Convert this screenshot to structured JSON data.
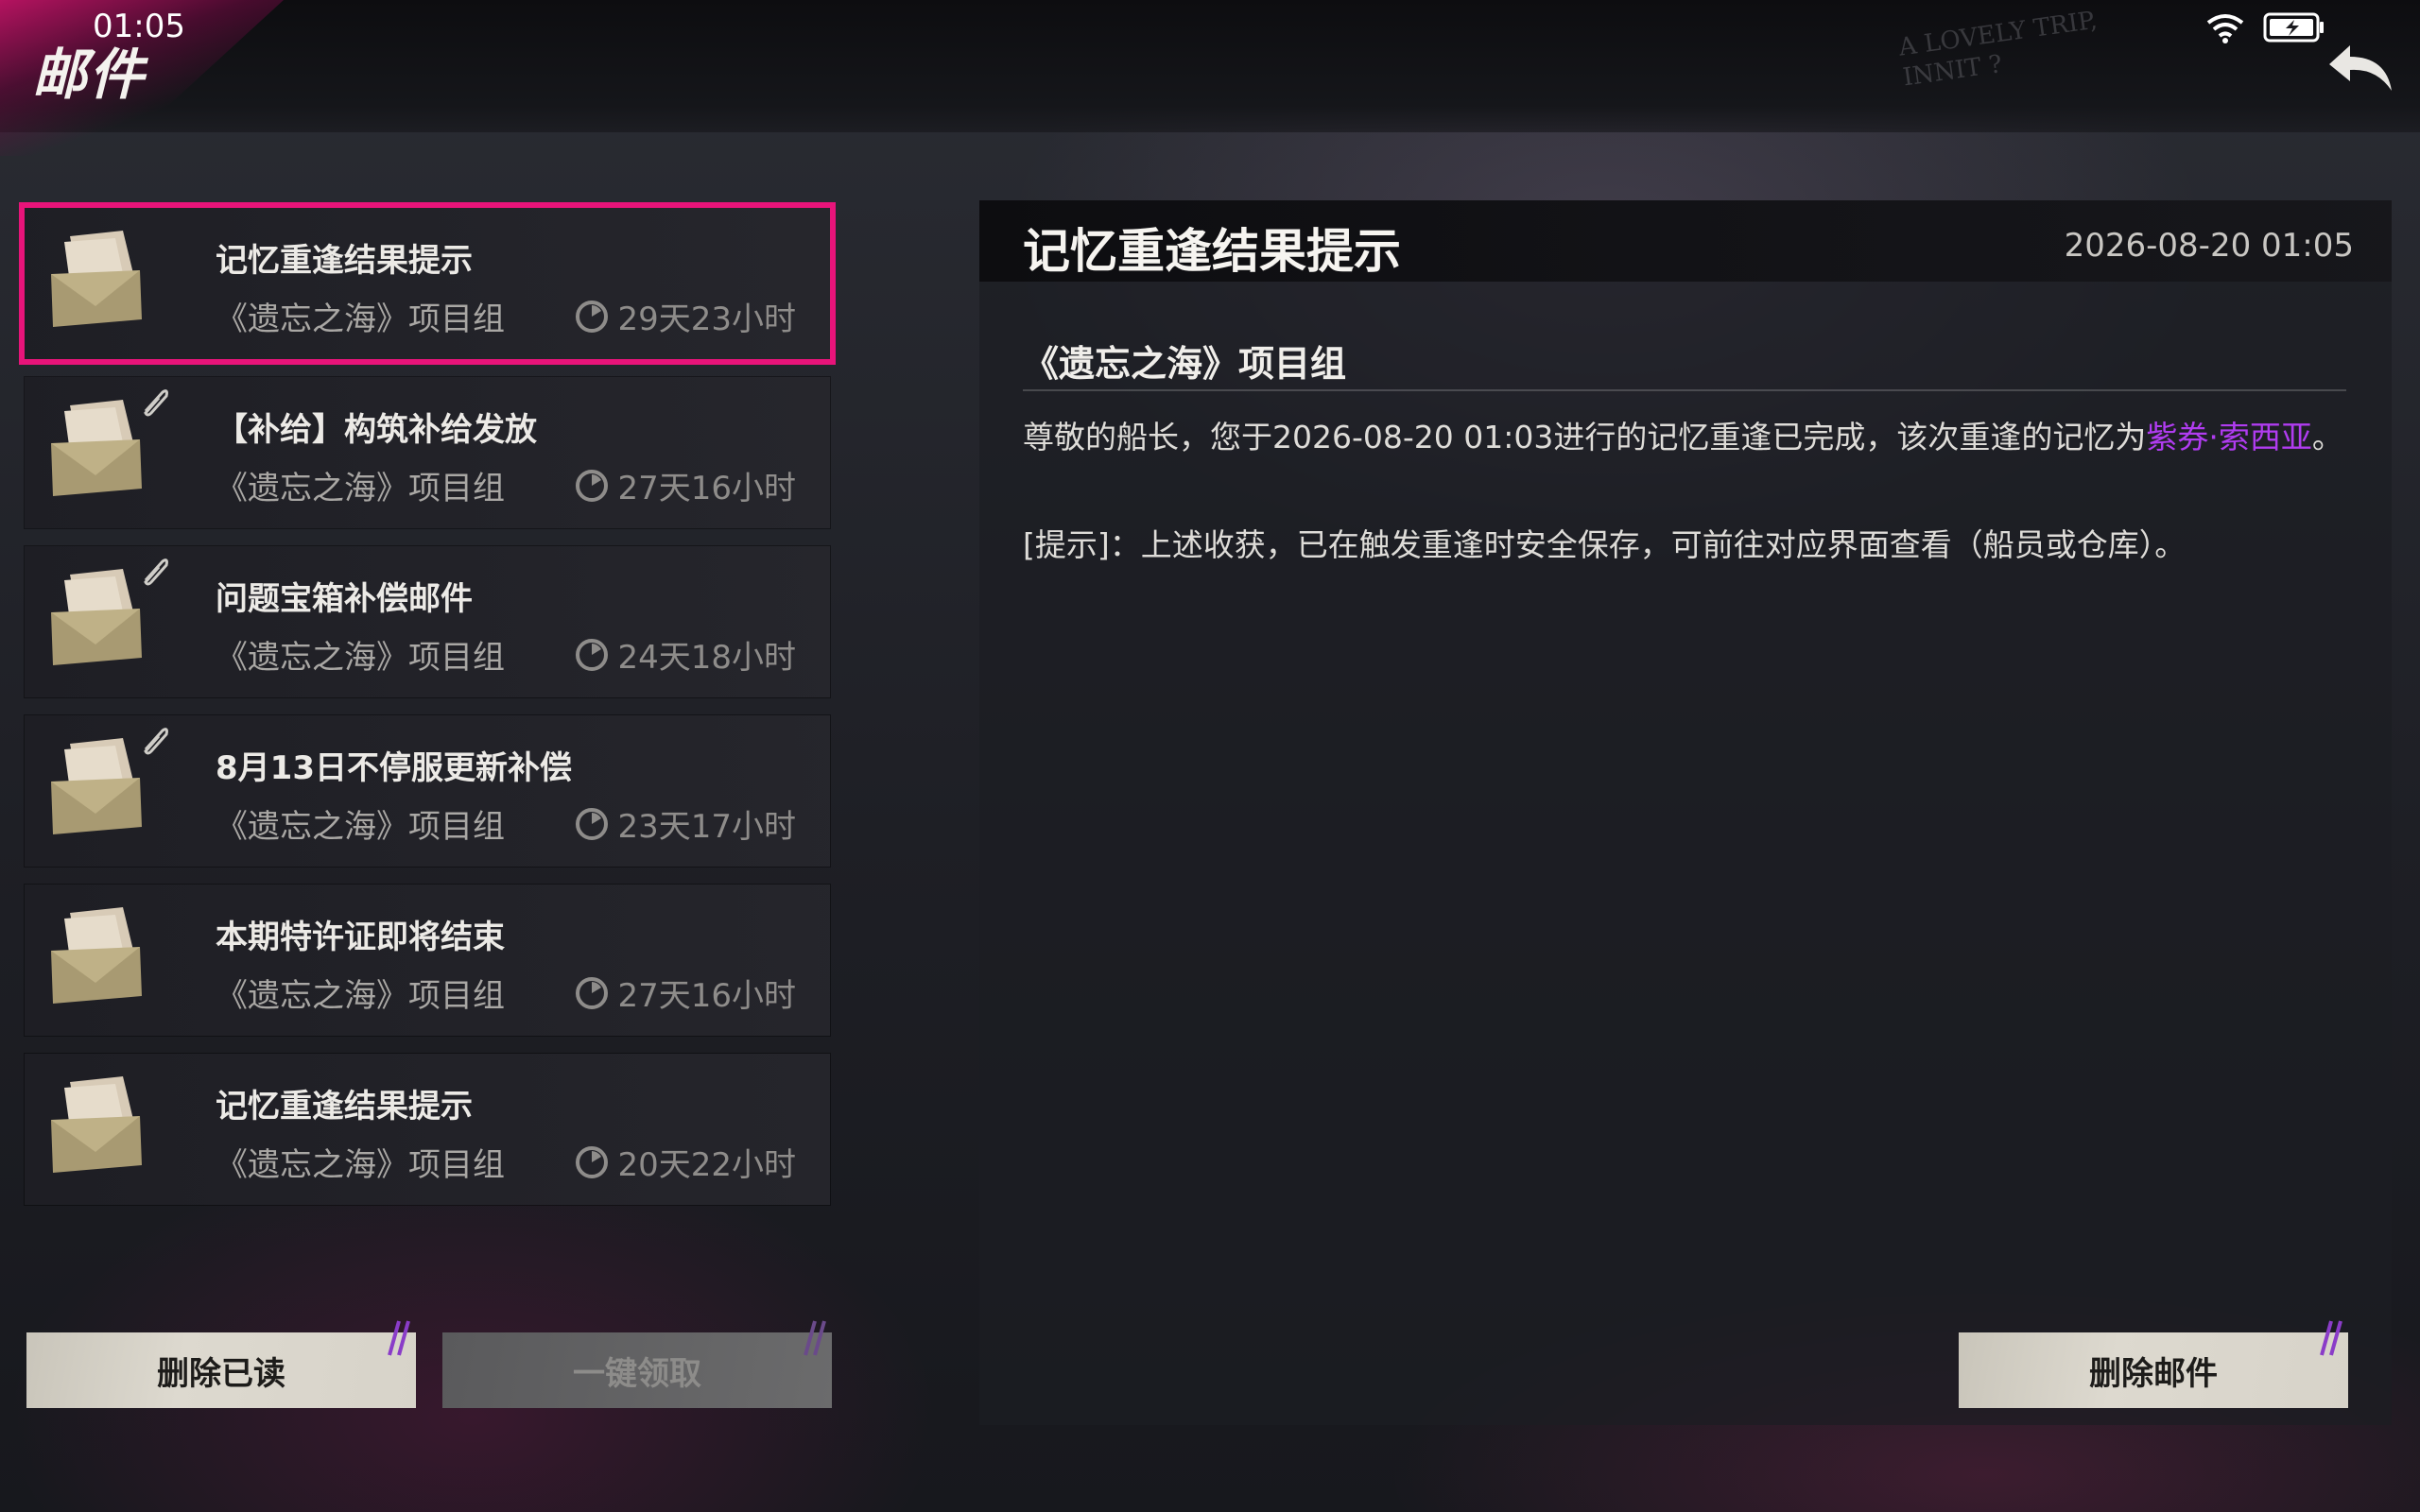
{
  "status_bar": {
    "time": "01:05"
  },
  "header": {
    "title": "邮件",
    "deco_line1": "A LOVELY TRIP,",
    "deco_line2": "INNIT ?"
  },
  "mails": [
    {
      "subject": "记忆重逢结果提示",
      "sender": "《遗忘之海》项目组",
      "expires": "29天23小时",
      "has_attachment": false,
      "selected": true
    },
    {
      "subject": "【补给】构筑补给发放",
      "sender": "《遗忘之海》项目组",
      "expires": "27天16小时",
      "has_attachment": true,
      "selected": false
    },
    {
      "subject": "问题宝箱补偿邮件",
      "sender": "《遗忘之海》项目组",
      "expires": "24天18小时",
      "has_attachment": true,
      "selected": false
    },
    {
      "subject": "8月13日不停服更新补偿",
      "sender": "《遗忘之海》项目组",
      "expires": "23天17小时",
      "has_attachment": true,
      "selected": false
    },
    {
      "subject": "本期特许证即将结束",
      "sender": "《遗忘之海》项目组",
      "expires": "27天16小时",
      "has_attachment": false,
      "selected": false
    },
    {
      "subject": "记忆重逢结果提示",
      "sender": "《遗忘之海》项目组",
      "expires": "20天22小时",
      "has_attachment": false,
      "selected": false
    }
  ],
  "buttons": {
    "delete_read": "删除已读",
    "claim_all": "一键领取",
    "delete_mail": "删除邮件"
  },
  "detail": {
    "title": "记忆重逢结果提示",
    "date": "2026-08-20 01:05",
    "sender": "《遗忘之海》项目组",
    "body_prefix": "尊敬的船长，您于2026-08-20 01:03进行的记忆重逢已完成，该次重逢的记忆为",
    "body_highlight": "紫券·索西亚",
    "body_suffix": "。",
    "hint": "[提示]：上述收获，已在触发重逢时安全保存，可前往对应界面查看（船员或仓库）。"
  },
  "colors": {
    "accent": "#e8147a",
    "highlight": "#b03cf0"
  }
}
